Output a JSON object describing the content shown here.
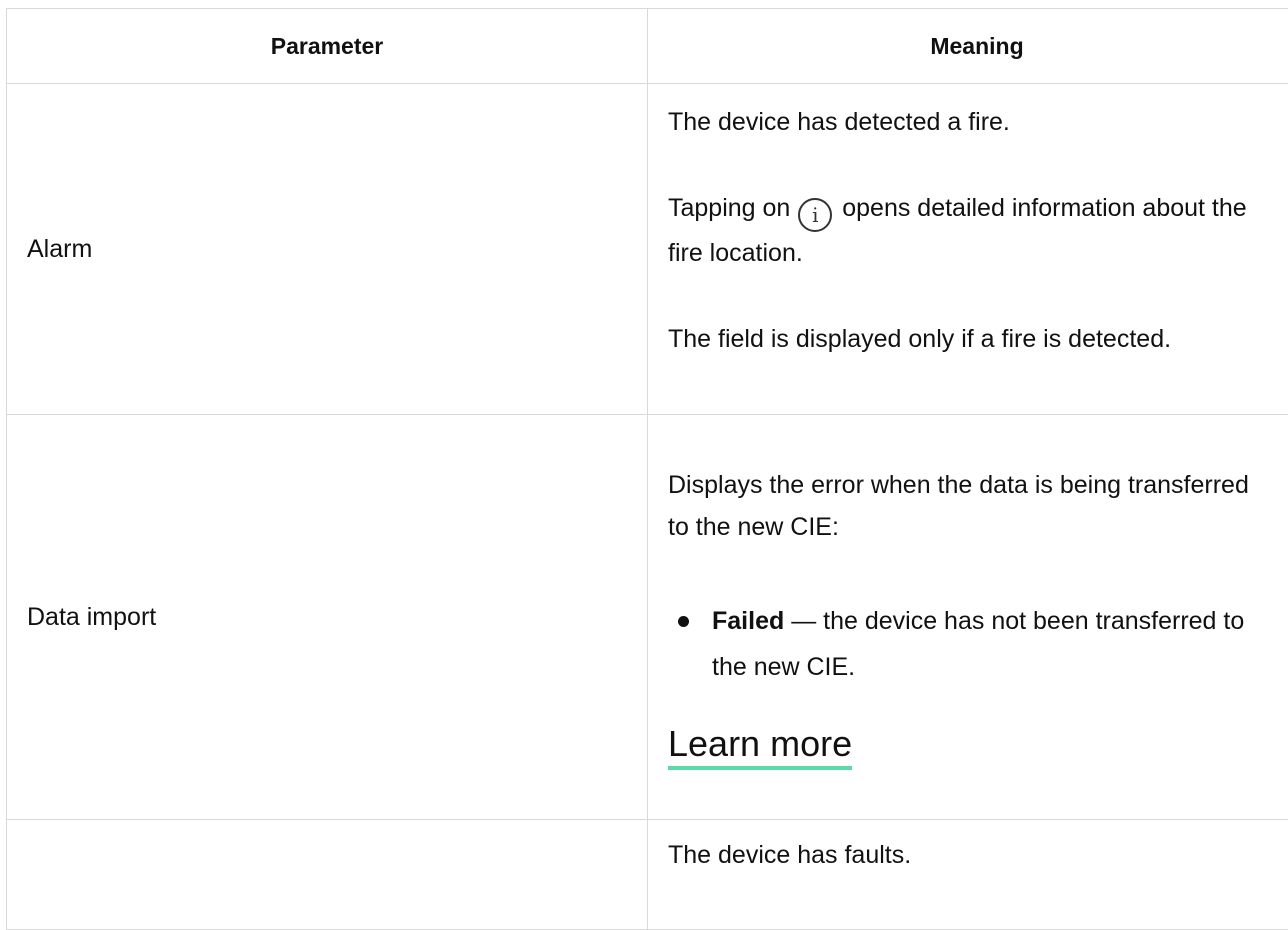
{
  "table": {
    "headers": {
      "parameter": "Parameter",
      "meaning": "Meaning"
    },
    "rows": [
      {
        "parameter": "Alarm",
        "meaning": {
          "p1": "The device has detected a fire.",
          "p2_before": "Tapping on",
          "p2_icon": "info-icon",
          "p2_after": "opens detailed information about the fire location.",
          "p3": "The field is displayed only if a fire is detected."
        }
      },
      {
        "parameter": "Data import",
        "meaning": {
          "p1": "Displays the error when the data is being transferred to the new CIE:",
          "bullet_bold": "Failed",
          "bullet_rest": "— the device has not been transferred to the new CIE.",
          "link": "Learn more",
          "link_underline_color": "#5ed9a8"
        }
      },
      {
        "parameter": "",
        "meaning": {
          "p1": "The device has faults."
        }
      }
    ]
  }
}
